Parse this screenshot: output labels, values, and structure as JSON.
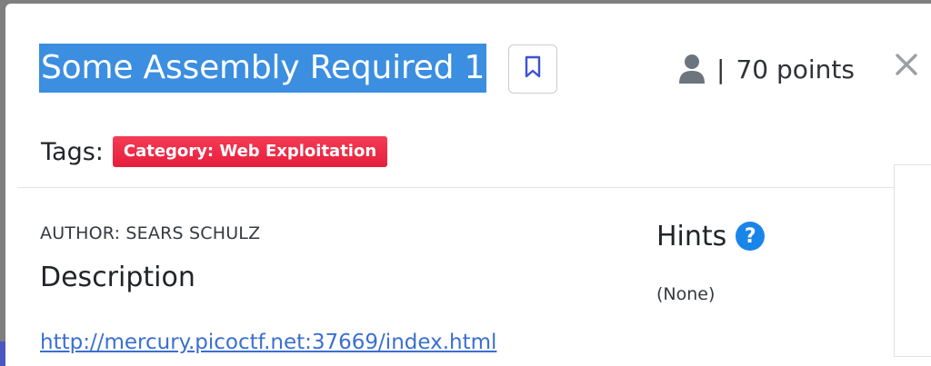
{
  "challenge": {
    "title": "Some Assembly Required 1",
    "points_label": "70 points",
    "separator": "|",
    "tags_label": "Tags:",
    "tags": [
      "Category: Web Exploitation"
    ],
    "author": "AUTHOR: SEARS SCHULZ",
    "description_heading": "Description",
    "description_link": "http://mercury.picoctf.net:37669/index.html"
  },
  "hints": {
    "heading": "Hints",
    "help_glyph": "?",
    "value": "(None)"
  },
  "icons": {
    "bookmark": "bookmark-icon",
    "user": "user-icon",
    "close": "close-icon",
    "help": "question-circle-icon"
  },
  "colors": {
    "title_selection_bg": "#3b8ee0",
    "tag_bg": "#e8223f",
    "link": "#3b6fd1",
    "help_icon": "#1a85e8"
  }
}
